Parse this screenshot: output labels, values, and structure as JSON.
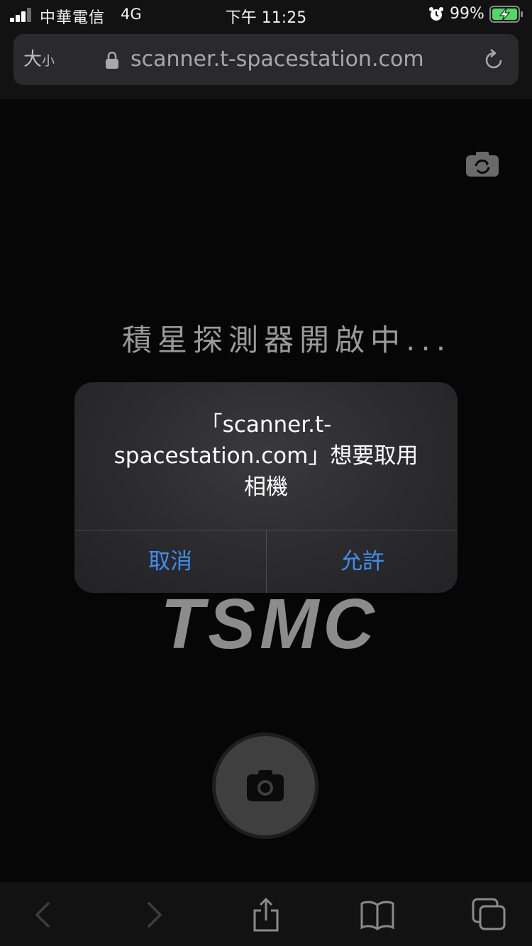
{
  "status_bar": {
    "carrier": "中華電信",
    "network": "4G",
    "time": "下午 11:25",
    "battery_percent": "99%",
    "icons": [
      "signal-icon",
      "alarm-icon",
      "battery-charging-icon"
    ]
  },
  "browser": {
    "text_size_label": "大",
    "text_size_label_small": "小",
    "url": "scanner.t-spacestation.com",
    "icons": [
      "lock-icon",
      "reload-icon"
    ]
  },
  "page": {
    "loading_text": "積星探測器開啟中...",
    "logo_text": "TSMC",
    "icons": [
      "camera-switch-icon",
      "camera-icon"
    ]
  },
  "alert": {
    "message_line1": "「scanner.t-",
    "message_line2": "spacestation.com」想要取用",
    "message_line3": "相機",
    "cancel_label": "取消",
    "allow_label": "允許",
    "accent_color": "#3f8ef0"
  },
  "toolbar": {
    "icons": [
      "back-icon",
      "forward-icon",
      "share-icon",
      "bookmarks-icon",
      "tabs-icon"
    ]
  }
}
